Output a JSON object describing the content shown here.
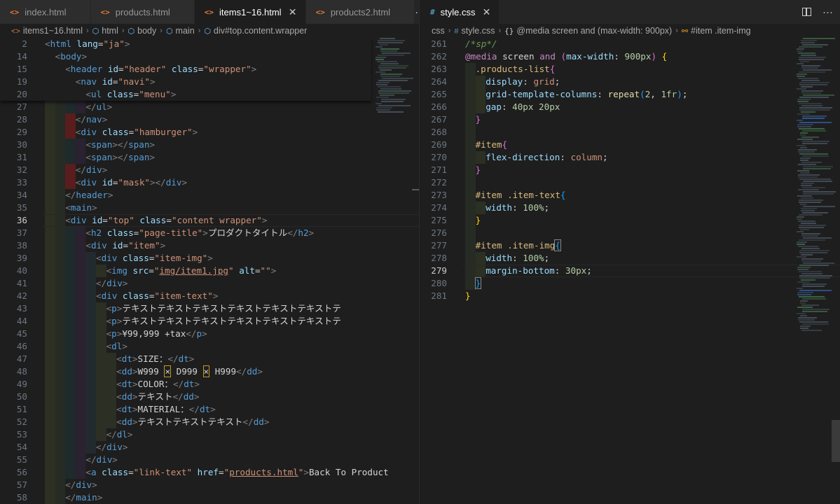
{
  "left": {
    "tabs": [
      {
        "name": "index.html",
        "active": false
      },
      {
        "name": "products.html",
        "active": false
      },
      {
        "name": "items1~16.html",
        "active": true
      },
      {
        "name": "products2.html",
        "active": false
      }
    ],
    "more_label": "···",
    "breadcrumbs": [
      "items1~16.html",
      "html",
      "body",
      "main",
      "div#top.content.wrapper"
    ]
  },
  "right": {
    "tabs": [
      {
        "name": "style.css",
        "active": true
      }
    ],
    "breadcrumbs": [
      "css",
      "style.css",
      "@media screen and (max-width: 900px)",
      "#item .item-img"
    ]
  },
  "html_code": [
    {
      "n": "2",
      "sticky": true,
      "code": "<html lang=\"ja\">"
    },
    {
      "n": "14",
      "sticky": true,
      "code": "  <body>"
    },
    {
      "n": "15",
      "sticky": true,
      "code": "    <header id=\"header\" class=\"wrapper\">"
    },
    {
      "n": "19",
      "sticky": true,
      "code": "      <nav id=\"navi\">"
    },
    {
      "n": "20",
      "sticky": true,
      "code": "        <ul class=\"menu\">"
    },
    {
      "n": "27",
      "code": "        </ul>"
    },
    {
      "n": "28",
      "code": "      </nav>"
    },
    {
      "n": "29",
      "code": "      <div class=\"hamburger\">"
    },
    {
      "n": "30",
      "code": "        <span></span>"
    },
    {
      "n": "31",
      "code": "        <span></span>"
    },
    {
      "n": "32",
      "code": "      </div>"
    },
    {
      "n": "33",
      "code": "      <div id=\"mask\"></div>"
    },
    {
      "n": "34",
      "code": "    </header>"
    },
    {
      "n": "35",
      "code": "    <main>"
    },
    {
      "n": "36",
      "code": "    <div id=\"top\" class=\"content wrapper\">"
    },
    {
      "n": "37",
      "code": "        <h2 class=\"page-title\">プロダクトタイトル</h2>"
    },
    {
      "n": "38",
      "code": "        <div id=\"item\">"
    },
    {
      "n": "39",
      "code": "          <div class=\"item-img\">"
    },
    {
      "n": "40",
      "code": "            <img src=\"img/item1.jpg\" alt=\"\">"
    },
    {
      "n": "41",
      "code": "          </div>"
    },
    {
      "n": "42",
      "code": "          <div class=\"item-text\">"
    },
    {
      "n": "43",
      "code": "            <p>テキストテキストテキストテキストテキストテキストテ"
    },
    {
      "n": "44",
      "code": "            <p>テキストテキストテキストテキストテキストテキストテ"
    },
    {
      "n": "45",
      "code": "            <p>¥99,999 +tax</p>"
    },
    {
      "n": "46",
      "code": "            <dl>"
    },
    {
      "n": "47",
      "code": "              <dt>SIZE：</dt>"
    },
    {
      "n": "48",
      "code": "              <dd>W999 × D999 × H999</dd>"
    },
    {
      "n": "49",
      "code": "              <dt>COLOR：</dt>"
    },
    {
      "n": "50",
      "code": "              <dd>テキスト</dd>"
    },
    {
      "n": "51",
      "code": "              <dt>MATERIAL：</dt>"
    },
    {
      "n": "52",
      "code": "              <dd>テキストテキストテキスト</dd>"
    },
    {
      "n": "53",
      "code": "            </dl>"
    },
    {
      "n": "54",
      "code": "          </div>"
    },
    {
      "n": "55",
      "code": "        </div>"
    },
    {
      "n": "56",
      "code": "        <a class=\"link-text\" href=\"products.html\">Back To Product"
    },
    {
      "n": "57",
      "code": "    </div>"
    },
    {
      "n": "58",
      "code": "    </main>"
    }
  ],
  "css_code": [
    {
      "n": "261",
      "code": "/*sp*/"
    },
    {
      "n": "262",
      "code": "@media screen and (max-width: 900px) {"
    },
    {
      "n": "263",
      "code": "  .products-list{"
    },
    {
      "n": "264",
      "code": "    display: grid;"
    },
    {
      "n": "265",
      "code": "    grid-template-columns: repeat(2, 1fr);"
    },
    {
      "n": "266",
      "code": "    gap: 40px 20px"
    },
    {
      "n": "267",
      "code": "}"
    },
    {
      "n": "268",
      "code": ""
    },
    {
      "n": "269",
      "code": "#item{"
    },
    {
      "n": "270",
      "code": "  flex-direction: column;"
    },
    {
      "n": "271",
      "code": "}"
    },
    {
      "n": "272",
      "code": ""
    },
    {
      "n": "273",
      "code": "  #item .item-text{"
    },
    {
      "n": "274",
      "code": "    width: 100%;"
    },
    {
      "n": "275",
      "code": "  }"
    },
    {
      "n": "276",
      "code": ""
    },
    {
      "n": "277",
      "code": "  #item .item-img{"
    },
    {
      "n": "278",
      "code": "    width: 100%;"
    },
    {
      "n": "279",
      "code": "    margin-bottom: 30px;"
    },
    {
      "n": "280",
      "code": "  }"
    },
    {
      "n": "281",
      "code": "}"
    }
  ],
  "html_current_line": "36",
  "css_current_line": "279",
  "colors": {
    "editor_bg": "#1e1e1e",
    "tabbar_bg": "#252526",
    "html_icon": "#e37933",
    "css_icon": "#519aba",
    "error_indent": "#5a1d1d"
  }
}
